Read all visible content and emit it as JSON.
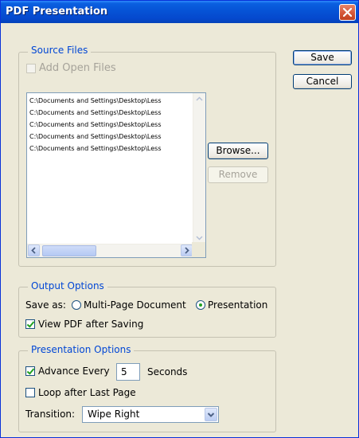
{
  "window": {
    "title": "PDF Presentation",
    "close_icon": "close-icon",
    "title_bar_color": "#0653d6"
  },
  "source_files": {
    "legend": "Source Files",
    "add_open_files_label": "Add Open Files",
    "add_open_files_checked": false,
    "add_open_files_enabled": false,
    "files": [
      "C:\\Documents and Settings\\Desktop\\Less",
      "C:\\Documents and Settings\\Desktop\\Less",
      "C:\\Documents and Settings\\Desktop\\Less",
      "C:\\Documents and Settings\\Desktop\\Less",
      "C:\\Documents and Settings\\Desktop\\Less"
    ],
    "browse_label": "Browse...",
    "remove_label": "Remove",
    "remove_enabled": false
  },
  "buttons": {
    "save_label": "Save",
    "cancel_label": "Cancel"
  },
  "output_options": {
    "legend": "Output Options",
    "save_as_label": "Save as:",
    "options": [
      "Multi-Page Document",
      "Presentation"
    ],
    "selected": "Presentation",
    "view_pdf_label": "View PDF after Saving",
    "view_pdf_checked": true
  },
  "presentation_options": {
    "legend": "Presentation Options",
    "advance_every_label": "Advance Every",
    "advance_every_checked": true,
    "advance_seconds": "5",
    "seconds_label": "Seconds",
    "loop_label": "Loop after Last Page",
    "loop_checked": false,
    "transition_label": "Transition:",
    "transition_value": "Wipe Right"
  },
  "colors": {
    "group_legend": "#0046d5",
    "dialog_bg": "#ece9d8",
    "check_mark": "#21a121"
  }
}
